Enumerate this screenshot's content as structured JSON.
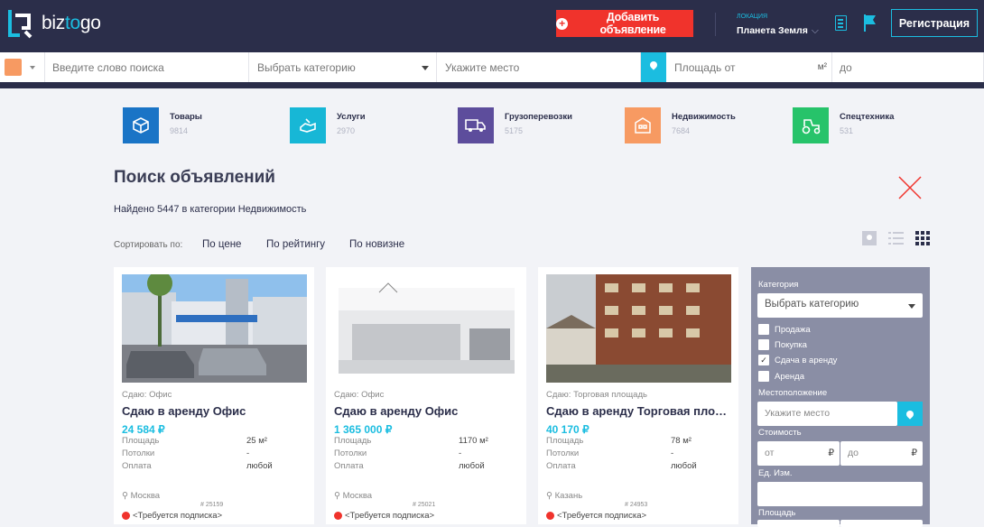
{
  "brand": {
    "name_a": "biz",
    "name_b": "to",
    "name_c": "go"
  },
  "header": {
    "add_label": "Добавить объявление",
    "location_caption": "ЛОКАЦИЯ",
    "location_value": "Планета Земля",
    "register_label": "Регистрация"
  },
  "search": {
    "keyword_placeholder": "Введите слово поиска",
    "category_placeholder": "Выбрать категорию",
    "place_placeholder": "Укажите место",
    "area_from_placeholder": "Площадь от",
    "area_unit": "м²",
    "area_to_placeholder": "до"
  },
  "categories": [
    {
      "label": "Товары",
      "count": "9814",
      "color": "#1a74c6"
    },
    {
      "label": "Услуги",
      "count": "2970",
      "color": "#17b7d6"
    },
    {
      "label": "Грузоперевозки",
      "count": "5175",
      "color": "#5d4d9c"
    },
    {
      "label": "Недвижимость",
      "count": "7684",
      "color": "#f79a62"
    },
    {
      "label": "Спецтехника",
      "count": "531",
      "color": "#27c36a"
    }
  ],
  "page": {
    "title": "Поиск объявлений",
    "found_text": "Найдено 5447 в категории Недвижимость"
  },
  "sort": {
    "label": "Сортировать по:",
    "options": [
      "По цене",
      "По рейтингу",
      "По новизне"
    ]
  },
  "listings": [
    {
      "subtitle": "Сдаю: Офис",
      "title": "Сдаю в аренду Офис",
      "price": "24 584 ₽",
      "area_label": "Площадь",
      "area": "25 м²",
      "ceiling_label": "Потолки",
      "ceiling": "-",
      "payment_label": "Оплата",
      "payment": "любой",
      "city": "Москва",
      "number": "# 25159",
      "requirement": "<Требуется подписка>"
    },
    {
      "subtitle": "Сдаю: Офис",
      "title": "Сдаю в аренду Офис",
      "price": "1 365 000 ₽",
      "area_label": "Площадь",
      "area": "1170 м²",
      "ceiling_label": "Потолки",
      "ceiling": "-",
      "payment_label": "Оплата",
      "payment": "любой",
      "city": "Москва",
      "number": "# 25021",
      "requirement": "<Требуется подписка>"
    },
    {
      "subtitle": "Сдаю: Торговая площадь",
      "title": "Сдаю в аренду Торговая площ...",
      "price": "40 170 ₽",
      "area_label": "Площадь",
      "area": "78 м²",
      "ceiling_label": "Потолки",
      "ceiling": "-",
      "payment_label": "Оплата",
      "payment": "любой",
      "city": "Казань",
      "number": "# 24953",
      "requirement": "<Требуется подписка>"
    }
  ],
  "filter": {
    "category_label": "Категория",
    "category_select": "Выбрать категорию",
    "options": [
      "Продажа",
      "Покупка",
      "Сдача в аренду",
      "Аренда"
    ],
    "checked_option": "Сдача в аренду",
    "location_label": "Местоположение",
    "location_placeholder": "Укажите место",
    "price_label": "Стоимость",
    "price_from": "от",
    "price_to": "до",
    "currency": "₽",
    "unit_label": "Ед. Изм.",
    "area_label": "Площадь"
  }
}
